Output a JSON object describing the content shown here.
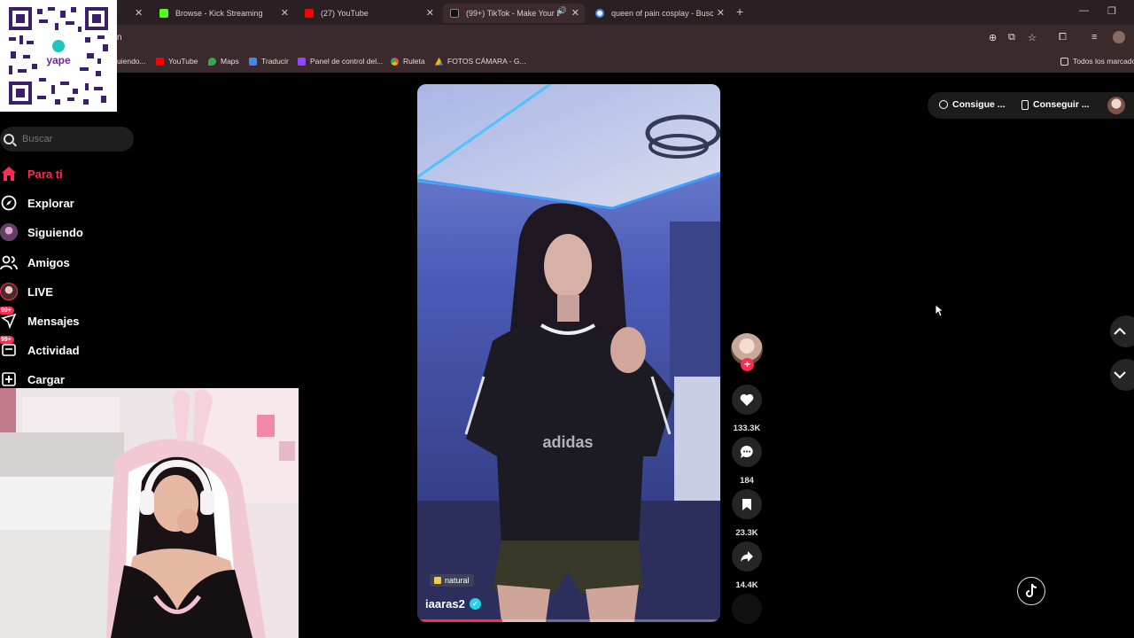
{
  "browser": {
    "tabs": [
      {
        "title": "Browse - Kick Streaming",
        "favicon_color": "#53fc18"
      },
      {
        "title": "(27) YouTube",
        "favicon_color": "#ff0000"
      },
      {
        "title": "(99+) TikTok - Make Your Da",
        "favicon_color": "#000000",
        "active": true
      },
      {
        "title": "queen of pain cosplay - Buscar",
        "favicon_color": "#4285f4"
      }
    ],
    "address_fragment": "n",
    "bookmarks": [
      {
        "label": "uiendo...",
        "color": "#e3dadd"
      },
      {
        "label": "YouTube",
        "color": "#ff0000"
      },
      {
        "label": "Maps",
        "color": "#34a853"
      },
      {
        "label": "Traducir",
        "color": "#4285f4"
      },
      {
        "label": "Panel de control del...",
        "color": "#9146ff"
      },
      {
        "label": "Ruleta",
        "color": "#e34d4d"
      },
      {
        "label": "FOTOS CÁMARA - G...",
        "color": "#f4b400"
      }
    ],
    "all_bookmarks": "Todos los marcado"
  },
  "sidebar": {
    "search_placeholder": "Buscar",
    "items": [
      {
        "label": "Para ti",
        "icon": "home-icon",
        "active": true
      },
      {
        "label": "Explorar",
        "icon": "compass-icon"
      },
      {
        "label": "Siguiendo",
        "icon": "following-avatar-icon"
      },
      {
        "label": "Amigos",
        "icon": "friends-icon"
      },
      {
        "label": "LIVE",
        "icon": "live-avatar-icon"
      },
      {
        "label": "Mensajes",
        "icon": "messages-icon",
        "badge": "99+"
      },
      {
        "label": "Actividad",
        "icon": "activity-icon",
        "badge": "99+"
      },
      {
        "label": "Cargar",
        "icon": "upload-icon"
      }
    ]
  },
  "video": {
    "tag": "natural",
    "author": "iaaras2",
    "progress_percent": 28
  },
  "actions": {
    "likes": "133.3K",
    "comments": "184",
    "saves": "23.3K",
    "shares": "14.4K"
  },
  "topright": {
    "get_coins": "Consigue ...",
    "get_app": "Conseguir ..."
  },
  "colors": {
    "accent": "#fe2c55",
    "verified": "#20d5ec"
  }
}
